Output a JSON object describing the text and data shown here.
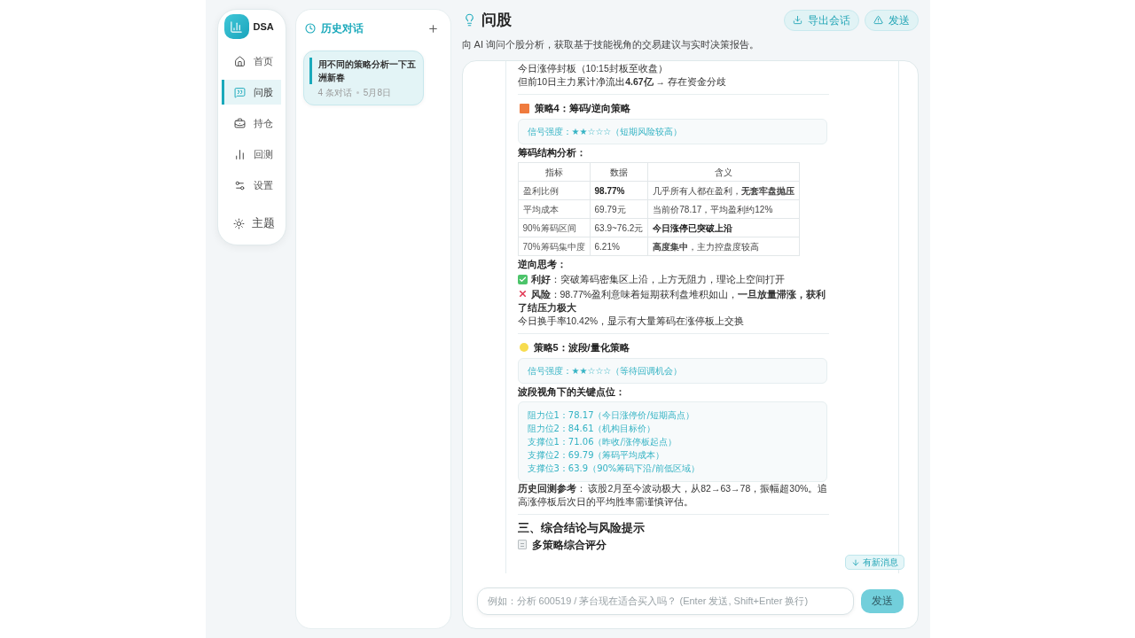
{
  "sidebar": {
    "app_name": "DSA",
    "items": [
      {
        "label": "首页",
        "selected": false
      },
      {
        "label": "问股",
        "selected": true
      },
      {
        "label": "持仓",
        "selected": false
      },
      {
        "label": "回测",
        "selected": false
      },
      {
        "label": "设置",
        "selected": false
      }
    ],
    "theme_toggle": {
      "label": "主题"
    }
  },
  "history": {
    "title": "历史对话",
    "conversations": [
      {
        "title": "用不同的策略分析一下五洲新春",
        "count": "4 条对话",
        "date": "5月8日",
        "selected": true
      }
    ]
  },
  "header": {
    "title": "问股",
    "subtitle": "向 AI 询问个股分析，获取基于技能视角的交易建议与实时决策报告。",
    "buttons": [
      {
        "label": "导出会话"
      },
      {
        "label": "发送"
      }
    ]
  },
  "message": {
    "blocks": [
      {
        "kind": "paragraph",
        "text": "今日涨停封板（10:15封板至收盘）"
      },
      {
        "kind": "paragraph",
        "text": "但前10日主力累计净流出**4.67亿** → 存在资金分歧"
      },
      {
        "kind": "divider"
      },
      {
        "kind": "strategy_heading",
        "marker": {
          "kind": "square",
          "color": "#ef7b3e"
        },
        "text": "策略4：筹码/逆向策略"
      },
      {
        "kind": "code",
        "lines": [
          "信号强度：★★☆☆☆（短期风险较高）"
        ]
      },
      {
        "kind": "label",
        "text": "筹码结构分析："
      },
      {
        "kind": "table",
        "columns": [
          "指标",
          "数据",
          "含义"
        ],
        "rows": [
          [
            {
              "text": "盈利比例",
              "bold": false
            },
            {
              "text": "98.77%",
              "bold": true
            },
            {
              "text": "几乎所有人都在盈利，**无套牢盘抛压**",
              "bold": false
            }
          ],
          [
            {
              "text": "平均成本",
              "bold": false
            },
            {
              "text": "69.79元",
              "bold": false
            },
            {
              "text": "当前价78.17，平均盈利约12%",
              "bold": false
            }
          ],
          [
            {
              "text": "90%筹码区间",
              "bold": false
            },
            {
              "text": "63.9~76.2元",
              "bold": false
            },
            {
              "text": "今日涨停已突破上沿",
              "bold": true
            }
          ],
          [
            {
              "text": "70%筹码集中度",
              "bold": false
            },
            {
              "text": "6.21%",
              "bold": false
            },
            {
              "text": "**高度集中**，主力控盘度较高",
              "bold": false
            }
          ]
        ]
      },
      {
        "kind": "label",
        "text": "逆向思考："
      },
      {
        "kind": "verdict",
        "positive": true,
        "text": "**利好**：突破筹码密集区上沿，上方无阻力，理论上空间打开"
      },
      {
        "kind": "verdict",
        "positive": false,
        "text": "**风险**：98.77%盈利意味着短期获利盘堆积如山，**一旦放量滞涨，获利了结压力极大**"
      },
      {
        "kind": "paragraph",
        "text": "今日换手率10.42%，显示有大量筹码在涨停板上交换"
      },
      {
        "kind": "divider"
      },
      {
        "kind": "strategy_heading",
        "marker": {
          "kind": "circle",
          "color": "#f7dc4f"
        },
        "text": "策略5：波段/量化策略"
      },
      {
        "kind": "code",
        "lines": [
          "信号强度：★★☆☆☆（等待回调机会）"
        ]
      },
      {
        "kind": "label",
        "text": "波段视角下的关键点位："
      },
      {
        "kind": "code",
        "lines": [
          "阻力位1：78.17（今日涨停价/短期高点）",
          "阻力位2：84.61（机构目标价）",
          "支撑位1：71.06（昨收/涨停板起点）",
          "支撑位2：69.79（筹码平均成本）",
          "支撑位3：63.9（90%筹码下沿/前低区域）"
        ]
      },
      {
        "kind": "paragraph",
        "text": "**历史回测参考**： 该股2月至今波动极大，从82→63→78，振幅超30%。追高涨停板后次日的平均胜率需谨慎评估。"
      },
      {
        "kind": "divider"
      },
      {
        "kind": "section_heading",
        "text": "三、综合结论与风险提示"
      },
      {
        "kind": "subheading",
        "text": "多策略综合评分"
      }
    ]
  },
  "new_messages": {
    "label": "有新消息"
  },
  "composer": {
    "placeholder": "例如：分析 600519 / 茅台现在适合买入吗？ (Enter 发送, Shift+Enter 换行)",
    "send_label": "发送"
  }
}
